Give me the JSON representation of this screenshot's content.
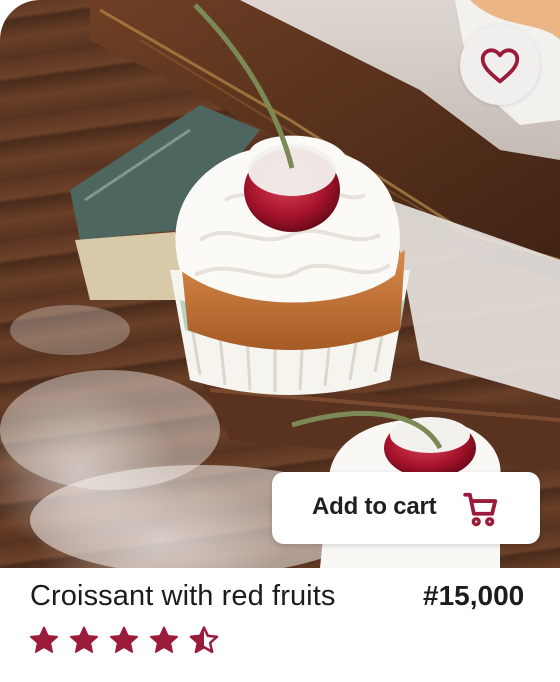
{
  "product": {
    "name": "Croissant with red fruits",
    "price": "#15,000",
    "rating": 4.5,
    "rating_max": 5
  },
  "actions": {
    "add_to_cart_label": "Add to cart",
    "cart_icon": "shopping-cart-icon",
    "favorite_icon": "heart-outline-icon"
  },
  "colors": {
    "accent": "#9b1c3a",
    "card_background": "#ffffff",
    "favorite_button_background": "#f1eeee",
    "text": "#1c1c1c"
  }
}
